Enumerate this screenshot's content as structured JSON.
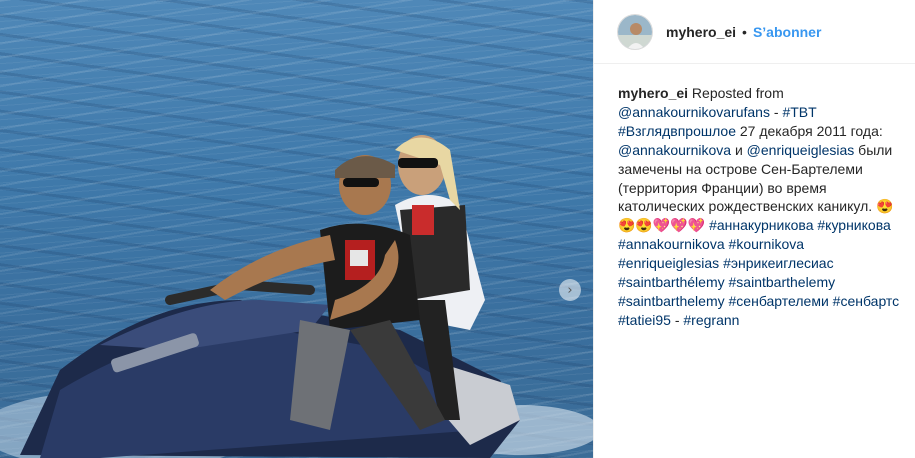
{
  "post": {
    "username": "myhero_ei",
    "separator": "•",
    "follow_label": "S’abonner",
    "next_icon": "chevron-right-icon"
  },
  "caption": {
    "username": "myhero_ei",
    "t1": " Reposted from ",
    "mention1": "@annakournikovarufans",
    "t2": " - ",
    "tag1": "#TBT",
    "t3": " ",
    "tag2": "#Взглядвпрошлое",
    "t4": " 27 декабря 2011 года: ",
    "mention2": "@annakournikova",
    "t5": " и ",
    "mention3": "@enriqueiglesias",
    "t6": " были замечены на острове Сен-Бартелеми (территория Франции) во время католических рождественских каникул. 😍😍😍💖💖💖 ",
    "tag3": "#аннакурникова",
    "tag4": "#курникова",
    "tag5": "#annakournikova",
    "tag6": "#kournikova",
    "tag7": "#enriqueiglesias",
    "tag8": "#энрикеиглесиас",
    "tag9": "#saintbarthélemy",
    "tag10": "#saintbarthelemy",
    "tag11": "#saintbarthelemy",
    "tag12": "#сенбартелеми",
    "tag13": "#сенбартс",
    "tag14": "#tatiei95",
    "t7": " - ",
    "tag15": "#regrann"
  },
  "colors": {
    "link": "#003569",
    "follow": "#3897f0",
    "text": "#262626",
    "sea": "#3f79aa"
  }
}
